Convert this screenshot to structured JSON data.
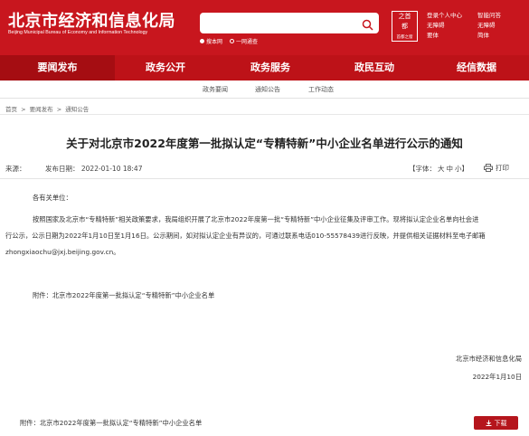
{
  "header": {
    "logo_cn": "北京市经济和信息化局",
    "logo_en": "Beijing Municipal Bureau of Economy and Information Technology",
    "search": {
      "placeholder": "",
      "value": ""
    },
    "radio": {
      "opt1": "搜本网",
      "opt2": "一网通查"
    },
    "badge": {
      "title1": "之首",
      "title2": "都",
      "sub": "首都之窗"
    },
    "access_left": [
      "登录个人中心",
      "无障碍",
      "要体"
    ],
    "access_right": [
      "智能问答",
      "无障碍",
      "简体"
    ]
  },
  "mainnav": [
    "要闻发布",
    "政务公开",
    "政务服务",
    "政民互动",
    "经信数据"
  ],
  "subnav": [
    "政务要闻",
    "通知公告",
    "工作动态"
  ],
  "breadcrumb": {
    "home": "首页",
    "sep": ">",
    "level1": "要闻发布",
    "level2": "通知公告"
  },
  "article": {
    "title": "关于对北京市2022年度第一批拟认定“专精特新”中小企业名单进行公示的通知",
    "source": "来源：",
    "date": "发布日期： 2022-01-10 18:47",
    "font_label": "【字体：",
    "font_sizes": [
      "大",
      "中",
      "小"
    ],
    "font_end": "】",
    "print": "打印",
    "greeting": "各有关单位：",
    "para_line1": "按照国家及北京市“专精特新”相关政策要求，我局组织开展了北京市2022年度第一批“专精特新”中小企业征集及评审工作。现将拟认定企业名单向社会进",
    "para_line2": "行公示，公示日期为2022年1月10日至1月16日。公示期间，如对拟认定企业有异议的，可通过联系电话010-55578439进行反映，并提供相关证据材料至电子邮箱",
    "para_line3": "zhongxiaochu@jxj.beijing.gov.cn。",
    "attach_label": "附件：",
    "attach_link": "北京市2022年度第一批拟认定“专精特新”中小企业名单",
    "sign_org": "北京市经济和信息化局",
    "sign_date": "2022年1月10日"
  },
  "attachment_bar": {
    "text": "附件：北京市2022年度第一批拟认定“专精特新”中小企业名单",
    "download": "下载"
  },
  "colors": {
    "brand_red": "#c8161e",
    "nav_active": "#a50d12"
  }
}
